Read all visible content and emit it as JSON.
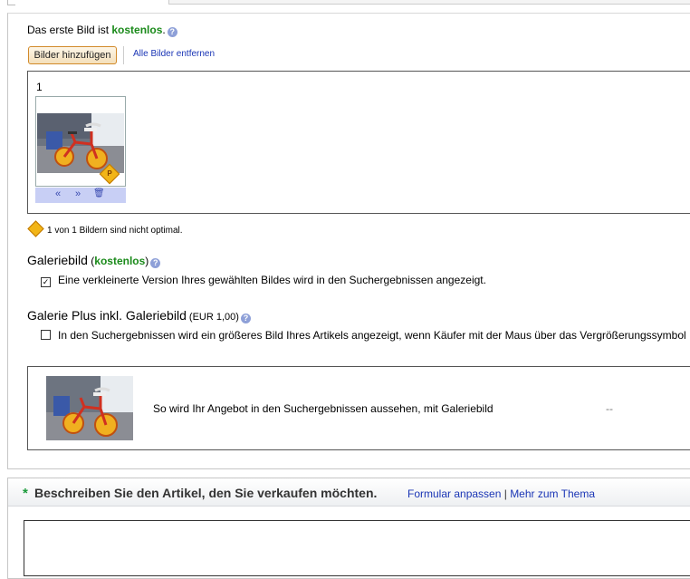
{
  "photo_section": {
    "first_image_prefix": "Das erste Bild ist ",
    "first_image_free": "kostenlos",
    "first_image_suffix": ".",
    "add_button": "Bilder hinzufügen",
    "remove_all_link": "Alle Bilder entfernen",
    "image_number": "1",
    "toolbar": {
      "move_left": "«",
      "move_right": "»",
      "delete": "🗑"
    },
    "warning_text": "1 von 1 Bildern sind nicht optimal.",
    "warning_badge": "P"
  },
  "gallery": {
    "title": "Galeriebild",
    "paren_open": " (",
    "free_label": "kostenlos",
    "paren_close": ")",
    "checkbox_label": "Eine verkleinerte Version Ihres gewählten Bildes wird in den Suchergebnissen angezeigt.",
    "checked": true
  },
  "gallery_plus": {
    "title": "Galerie Plus inkl. Galeriebild",
    "price": " (EUR 1,00)",
    "checkbox_label": "In den Suchergebnissen wird ein größeres Bild Ihres Artikels angezeigt, wenn Käufer mit der Maus über das Vergrößerungssymbol",
    "checked": false
  },
  "preview": {
    "text": "So wird Ihr Angebot in den Suchergebnissen aussehen, mit Galeriebild",
    "dash": "--"
  },
  "describe": {
    "required_marker": "*",
    "title": "Beschreiben Sie den Artikel, den Sie verkaufen möchten.",
    "link_customize": "Formular anpassen",
    "separator": " | ",
    "link_more": "Mehr zum Thema"
  },
  "colors": {
    "free_green": "#1a8a1a",
    "link_blue": "#1a35b5",
    "warning_orange": "#f2b517"
  }
}
